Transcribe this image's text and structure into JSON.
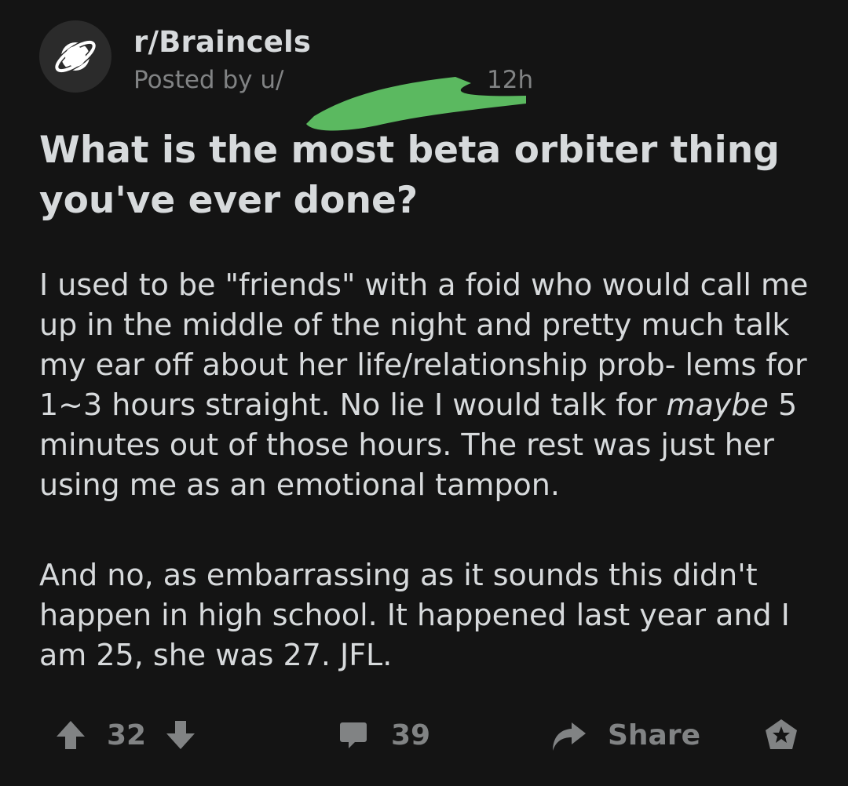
{
  "post": {
    "subreddit": "r/Braincels",
    "posted_by_prefix": "Posted by u/",
    "time_ago": "12h",
    "title": "What is the most beta orbiter thing you've ever done?",
    "body_p1_before": "I used to be \"friends\" with a foid who would call me up in the middle of the night and pretty much talk my ear off about her life/relationship prob- lems for 1~3 hours straight. No lie I would talk for ",
    "body_p1_emphasis": "maybe",
    "body_p1_after": " 5 minutes out of those hours. The rest was just her using me as an emotional tampon.",
    "body_p2": "And no, as embarrassing as it sounds this didn't happen in high school. It happened last year and I am 25, she was 27. JFL."
  },
  "actions": {
    "vote_count": "32",
    "comment_count": "39",
    "share_label": "Share"
  },
  "icons": {
    "subreddit": "planet-icon",
    "upvote": "arrow-up-icon",
    "downvote": "arrow-down-icon",
    "comments": "comment-bubble-icon",
    "share": "share-arrow-icon",
    "award": "award-icon"
  },
  "colors": {
    "background": "#141414",
    "text": "#d7dadc",
    "muted": "#818384",
    "redaction": "#5bb960"
  }
}
